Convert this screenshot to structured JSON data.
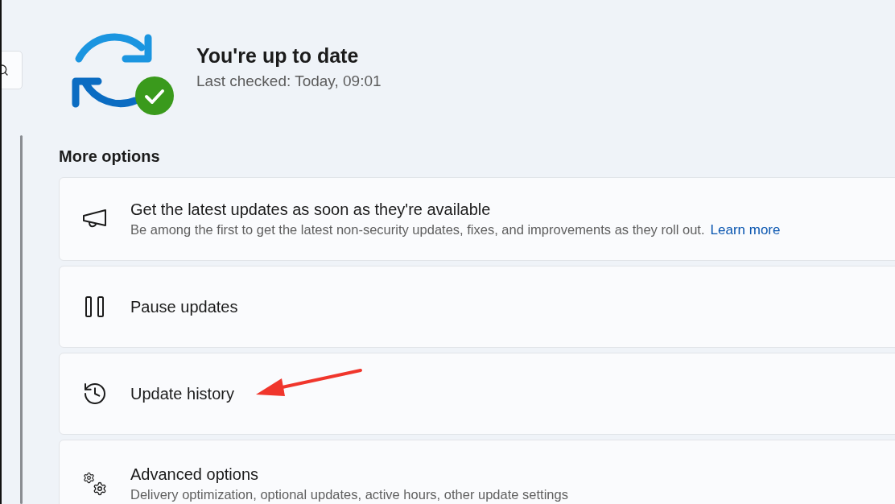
{
  "status": {
    "up_to_date": true,
    "title": "You're up to date",
    "subtitle": "Last checked: Today, 09:01"
  },
  "more_options": {
    "heading": "More options",
    "items": [
      {
        "kind": "megaphone",
        "title": "Get the latest updates as soon as they're available",
        "description": "Be among the first to get the latest non-security updates, fixes, and improvements as they roll out.",
        "link": "Learn more"
      },
      {
        "kind": "pause",
        "title": "Pause updates"
      },
      {
        "kind": "history",
        "title": "Update history"
      },
      {
        "kind": "gears",
        "title": "Advanced options",
        "description": "Delivery optimization, optional updates, active hours, other update settings"
      }
    ]
  }
}
